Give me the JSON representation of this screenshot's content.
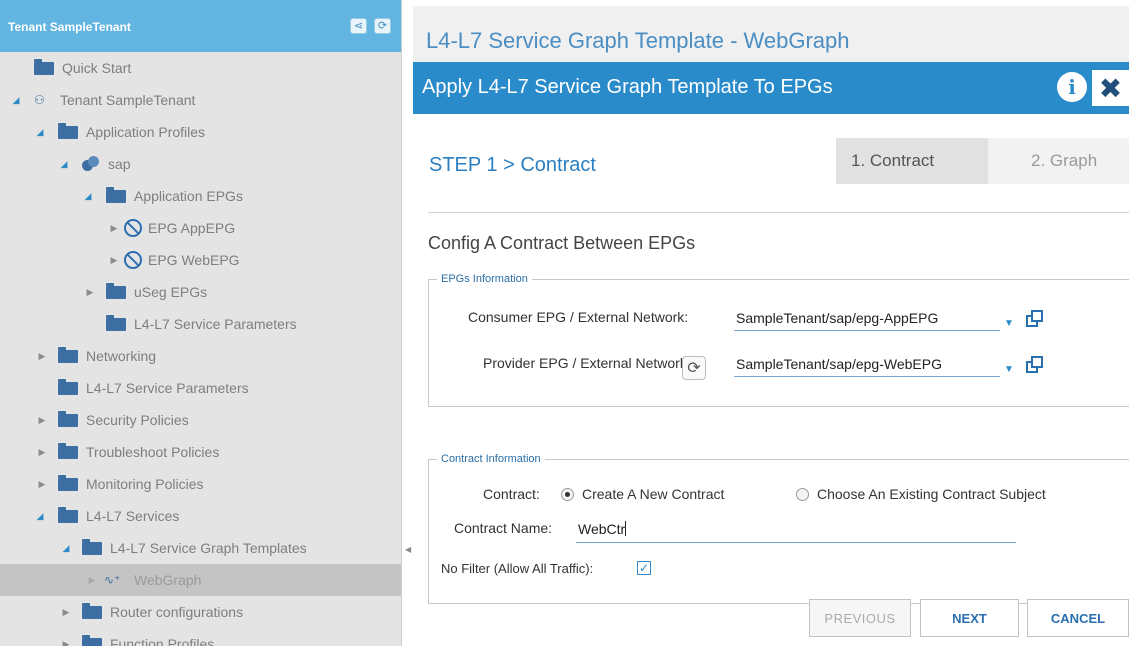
{
  "tree_header": {
    "title": "Tenant SampleTenant"
  },
  "tree": {
    "quick_start": "Quick Start",
    "tenant": "Tenant SampleTenant",
    "application_profiles": "Application Profiles",
    "sap": "sap",
    "application_epgs": "Application EPGs",
    "epg_app": "EPG AppEPG",
    "epg_web": "EPG WebEPG",
    "useg_epgs": "uSeg EPGs",
    "l4l7_params_inner": "L4-L7 Service Parameters",
    "networking": "Networking",
    "l4l7_params": "L4-L7 Service Parameters",
    "security_policies": "Security Policies",
    "troubleshoot_policies": "Troubleshoot Policies",
    "monitoring_policies": "Monitoring Policies",
    "l4l7_services": "L4-L7 Services",
    "l4l7_graph_templates": "L4-L7 Service Graph Templates",
    "webgraph": "WebGraph",
    "router_configurations": "Router configurations",
    "function_profiles": "Function Profiles"
  },
  "main": {
    "graph_title": "L4-L7 Service Graph Template - WebGraph",
    "dialog_title": "Apply L4-L7 Service Graph Template To EPGs",
    "info_glyph": "i",
    "close_glyph": "✖",
    "step_label": "STEP 1 > Contract",
    "wizard_steps": [
      "1. Contract",
      "2. Graph"
    ],
    "config_title": "Config A Contract Between EPGs"
  },
  "epgs_info": {
    "legend": "EPGs Information",
    "consumer_label": "Consumer EPG / External Network:",
    "consumer_value": "SampleTenant/sap/epg-AppEPG",
    "provider_label": "Provider EPG / External Network:",
    "provider_value": "SampleTenant/sap/epg-WebEPG"
  },
  "contract_info": {
    "legend": "Contract Information",
    "contract_label": "Contract:",
    "option_new": "Create A New Contract",
    "option_existing": "Choose An Existing Contract Subject",
    "selected_option": "Create A New Contract",
    "name_label": "Contract Name:",
    "name_value": "WebCtr",
    "no_filter_label": "No Filter (Allow All Traffic):",
    "no_filter_checked": true
  },
  "buttons": {
    "previous": "PREVIOUS",
    "next": "NEXT",
    "cancel": "CANCEL"
  },
  "colors": {
    "accent": "#2a8bcb",
    "tree_header": "#62b5e0",
    "folder": "#3d6ea1"
  }
}
